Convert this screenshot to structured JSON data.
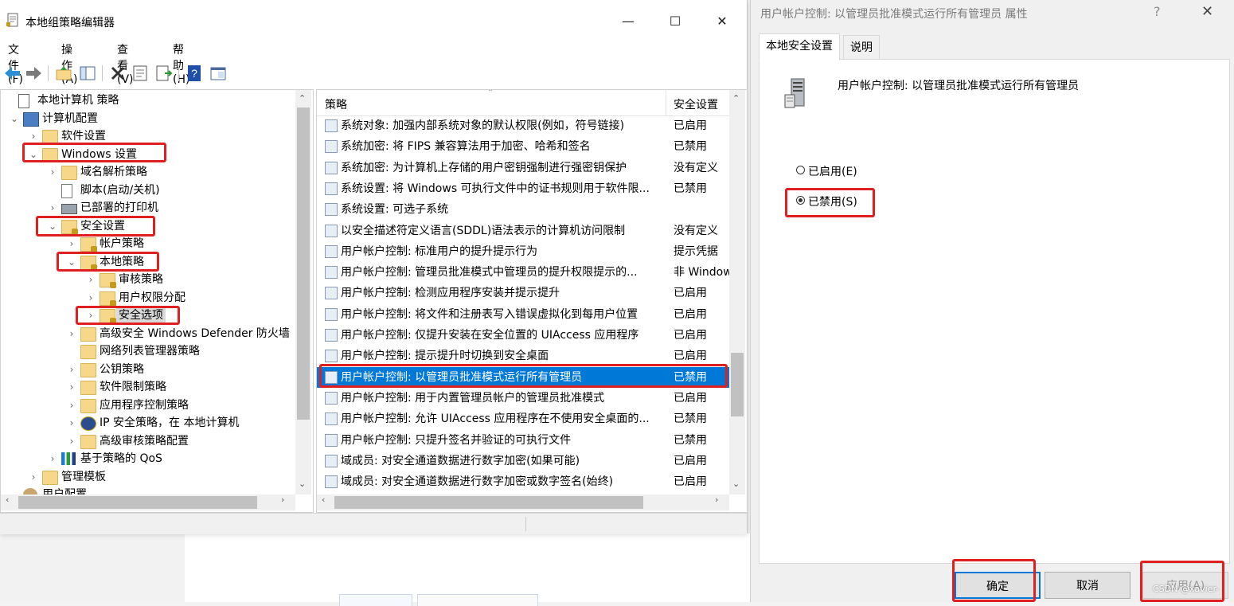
{
  "mmc": {
    "title": "本地组策略编辑器",
    "controls": {
      "minimize": "—",
      "maximize": "☐",
      "close": "✕"
    },
    "menu": [
      "文件(F)",
      "操作(A)",
      "查看(V)",
      "帮助(H)"
    ]
  },
  "tree": {
    "nodes": [
      {
        "label": "本地计算机 策略",
        "expander": "",
        "icon": "policy-doc-icon"
      },
      {
        "label": "计算机配置",
        "expander": "⌄",
        "icon": "computer-icon"
      },
      {
        "label": "软件设置",
        "expander": "›",
        "icon": "folder-icon"
      },
      {
        "label": "Windows 设置",
        "expander": "⌄",
        "icon": "folder-icon"
      },
      {
        "label": "域名解析策略",
        "expander": "›",
        "icon": "folder-icon"
      },
      {
        "label": "脚本(启动/关机)",
        "expander": "",
        "icon": "script-icon"
      },
      {
        "label": "已部署的打印机",
        "expander": "›",
        "icon": "printer-icon"
      },
      {
        "label": "安全设置",
        "expander": "⌄",
        "icon": "security-folder-icon"
      },
      {
        "label": "帐户策略",
        "expander": "›",
        "icon": "security-folder-icon"
      },
      {
        "label": "本地策略",
        "expander": "⌄",
        "icon": "security-folder-icon"
      },
      {
        "label": "审核策略",
        "expander": "›",
        "icon": "security-folder-icon"
      },
      {
        "label": "用户权限分配",
        "expander": "›",
        "icon": "security-folder-icon"
      },
      {
        "label": "安全选项",
        "expander": "›",
        "icon": "security-folder-icon"
      },
      {
        "label": "高级安全 Windows Defender 防火墙",
        "expander": "›",
        "icon": "folder-icon"
      },
      {
        "label": "网络列表管理器策略",
        "expander": "",
        "icon": "folder-icon"
      },
      {
        "label": "公钥策略",
        "expander": "›",
        "icon": "folder-icon"
      },
      {
        "label": "软件限制策略",
        "expander": "›",
        "icon": "folder-icon"
      },
      {
        "label": "应用程序控制策略",
        "expander": "›",
        "icon": "folder-icon"
      },
      {
        "label": "IP 安全策略，在 本地计算机",
        "expander": "›",
        "icon": "ip-security-icon"
      },
      {
        "label": "高级审核策略配置",
        "expander": "›",
        "icon": "folder-icon"
      },
      {
        "label": "基于策略的 QoS",
        "expander": "›",
        "icon": "qos-chart-icon"
      },
      {
        "label": "管理模板",
        "expander": "›",
        "icon": "folder-icon"
      },
      {
        "label": "用户配置",
        "expander": "⌄",
        "icon": "user-icon"
      }
    ]
  },
  "list": {
    "col_policy": "策略",
    "col_setting": "安全设置",
    "rows": [
      {
        "name": "系统对象: 加强内部系统对象的默认权限(例如，符号链接)",
        "value": "已启用"
      },
      {
        "name": "系统加密: 将 FIPS 兼容算法用于加密、哈希和签名",
        "value": "已禁用"
      },
      {
        "name": "系统加密: 为计算机上存储的用户密钥强制进行强密钥保护",
        "value": "没有定义"
      },
      {
        "name": "系统设置: 将 Windows 可执行文件中的证书规则用于软件限...",
        "value": "已禁用"
      },
      {
        "name": "系统设置: 可选子系统",
        "value": ""
      },
      {
        "name": "以安全描述符定义语言(SDDL)语法表示的计算机访问限制",
        "value": "没有定义"
      },
      {
        "name": "用户帐户控制: 标准用户的提升提示行为",
        "value": "提示凭据"
      },
      {
        "name": "用户帐户控制: 管理员批准模式中管理员的提升权限提示的...",
        "value": "非 Windows"
      },
      {
        "name": "用户帐户控制: 检测应用程序安装并提示提升",
        "value": "已启用"
      },
      {
        "name": "用户帐户控制: 将文件和注册表写入错误虚拟化到每用户位置",
        "value": "已启用"
      },
      {
        "name": "用户帐户控制: 仅提升安装在安全位置的 UIAccess 应用程序",
        "value": "已启用"
      },
      {
        "name": "用户帐户控制: 提示提升时切换到安全桌面",
        "value": "已启用"
      },
      {
        "name": "用户帐户控制: 以管理员批准模式运行所有管理员",
        "value": "已禁用"
      },
      {
        "name": "用户帐户控制: 用于内置管理员帐户的管理员批准模式",
        "value": "已启用"
      },
      {
        "name": "用户帐户控制: 允许 UIAccess 应用程序在不使用安全桌面的...",
        "value": "已禁用"
      },
      {
        "name": "用户帐户控制: 只提升签名并验证的可执行文件",
        "value": "已禁用"
      },
      {
        "name": "域成员: 对安全通道数据进行数字加密(如果可能)",
        "value": "已启用"
      },
      {
        "name": "域成员: 对安全通道数据进行数字加密或数字签名(始终)",
        "value": "已启用"
      }
    ]
  },
  "dialog": {
    "title": "用户帐户控制: 以管理员批准模式运行所有管理员 属性",
    "help": "?",
    "close": "✕",
    "tabs": [
      "本地安全设置",
      "说明"
    ],
    "policy_name": "用户帐户控制: 以管理员批准模式运行所有管理员",
    "enabled_label": "已启用(E)",
    "disabled_label": "已禁用(S)",
    "selected": "disabled",
    "ok": "确定",
    "cancel": "取消",
    "apply": "应用(A)"
  },
  "watermark": "CSDN @xavier-",
  "colors": {
    "selection": "#0078d7",
    "annotation": "#e02020"
  }
}
